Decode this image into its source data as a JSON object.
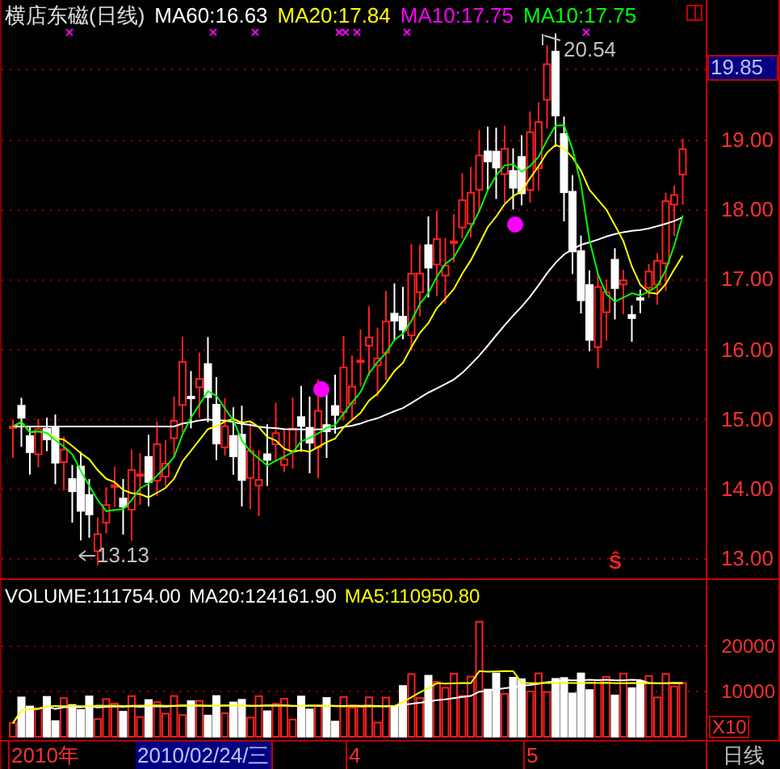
{
  "chart_title": "横店东磁(日线)",
  "indicators": [
    {
      "label": "MA60:16.63",
      "color": "#ffffff"
    },
    {
      "label": "MA20:17.84",
      "color": "#ffff00"
    },
    {
      "label": "MA10:17.75",
      "color": "#ff00ff"
    },
    {
      "label": "MA10:17.75",
      "color": "#00ff00"
    }
  ],
  "annotations": {
    "high": "20.54",
    "low": "13.13",
    "signal": "Ŝ"
  },
  "price_axis": {
    "labels": [
      "19.00",
      "18.00",
      "17.00",
      "16.00",
      "15.00",
      "14.00",
      "13.00"
    ],
    "current_price": "19.85"
  },
  "volume_panel": {
    "indicators": [
      {
        "label": "VOLUME:111754.00",
        "color": "#ffffff"
      },
      {
        "label": "MA20:124161.90",
        "color": "#ffffff"
      },
      {
        "label": "MA5:110950.80",
        "color": "#ffff00"
      }
    ],
    "axis_labels": [
      "20000",
      "10000"
    ],
    "scale": "X10"
  },
  "time_bar": {
    "items": [
      {
        "label": "2010年",
        "selected": false
      },
      {
        "label": "2010/02/24/三",
        "selected": true
      },
      {
        "label": "4",
        "selected": false
      },
      {
        "label": "5",
        "selected": false
      }
    ],
    "period": "日线"
  }
}
